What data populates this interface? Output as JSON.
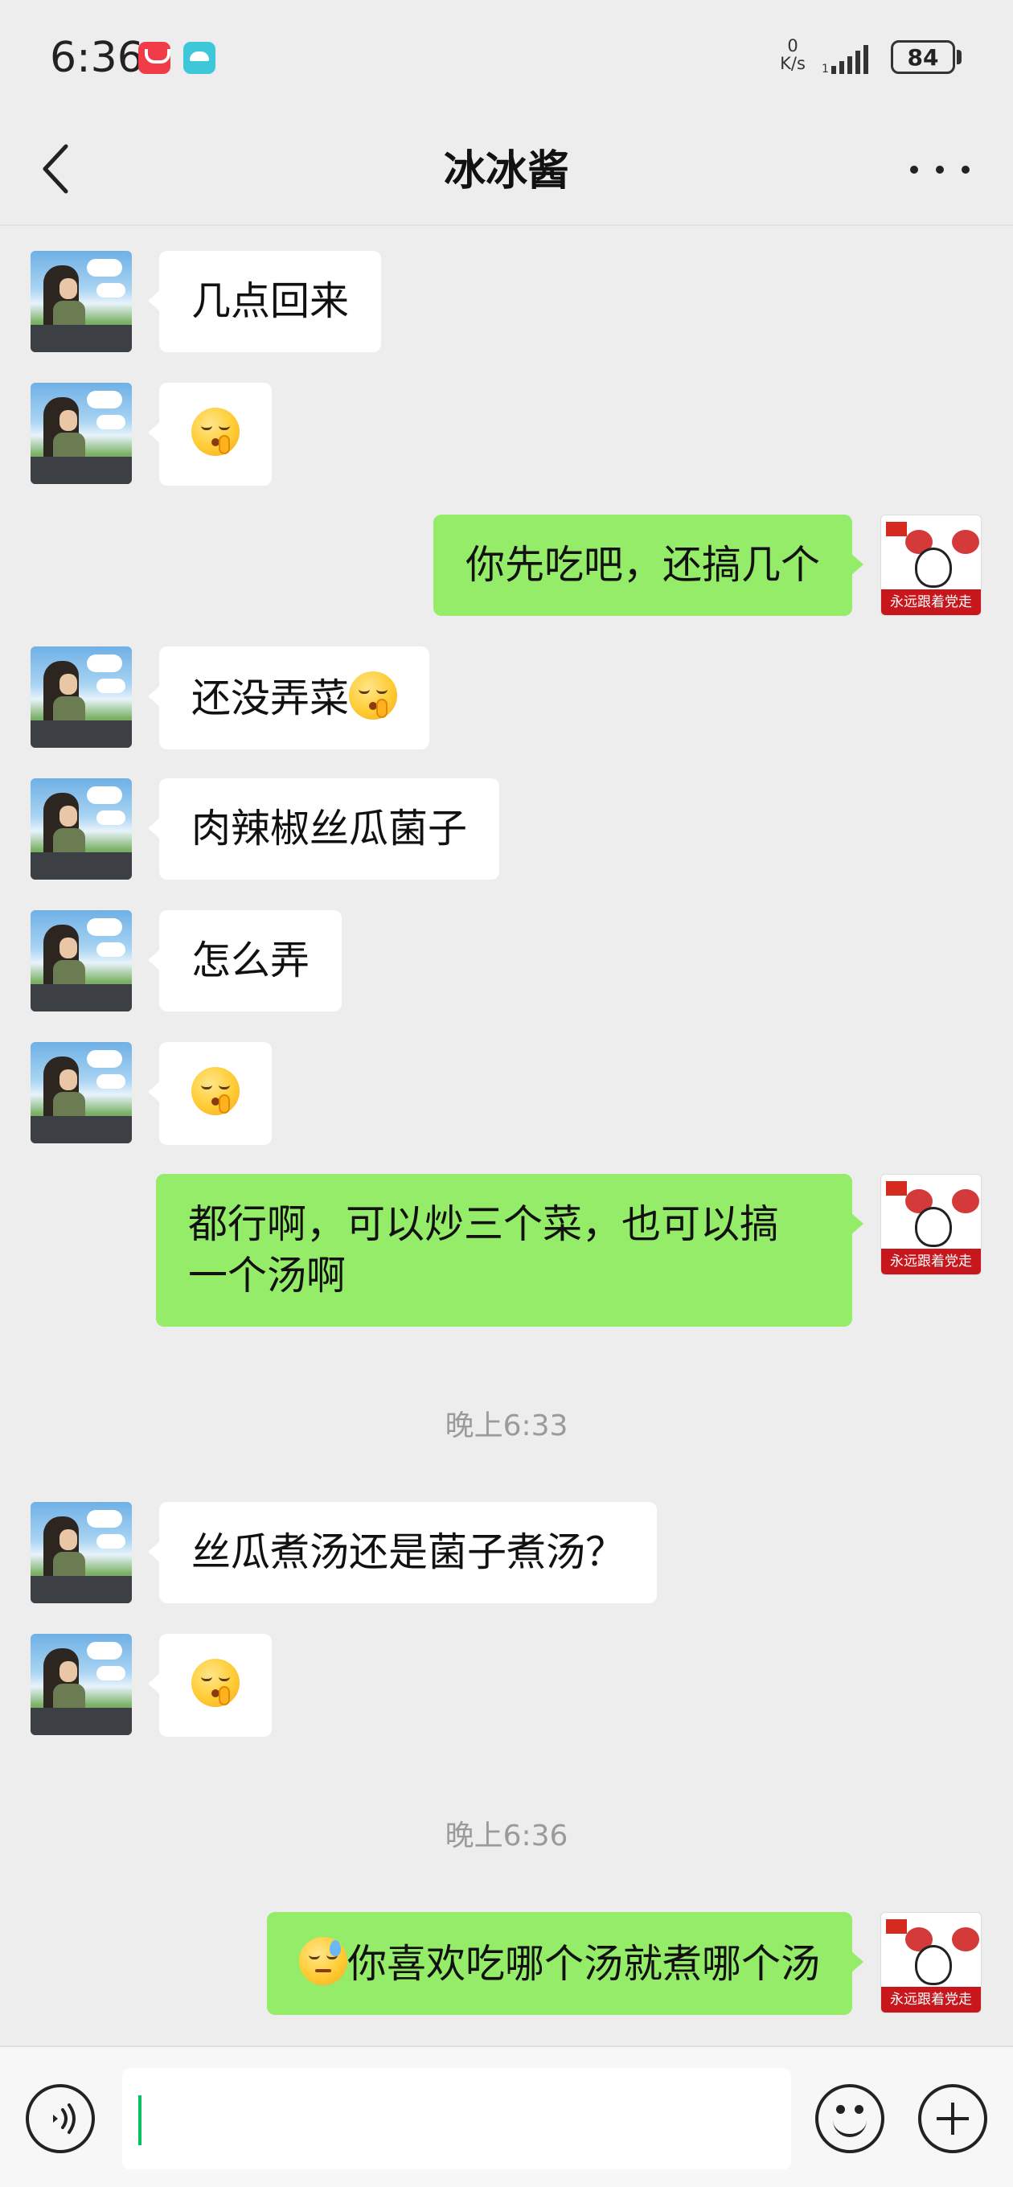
{
  "status_bar": {
    "time": "6:36",
    "net_speed_value": "0",
    "net_speed_unit": "K/s",
    "battery": "84",
    "icons": [
      "huawei-appgallery-icon",
      "camel-app-icon",
      "signal-icon",
      "battery-icon"
    ]
  },
  "header": {
    "title": "冰冰酱",
    "back_icon": "chevron-left-icon",
    "more_icon": "more-dots-icon"
  },
  "messages": [
    {
      "side": "left",
      "text": "几点回来",
      "emoji": null
    },
    {
      "side": "left",
      "text": "",
      "emoji": "shushing-face"
    },
    {
      "side": "right",
      "text": "你先吃吧，还搞几个",
      "emoji": null
    },
    {
      "side": "left",
      "text": "还没弄菜",
      "emoji": "shushing-face"
    },
    {
      "side": "left",
      "text": "肉辣椒丝瓜菌子",
      "emoji": null
    },
    {
      "side": "left",
      "text": "怎么弄",
      "emoji": null
    },
    {
      "side": "left",
      "text": "",
      "emoji": "shushing-face"
    },
    {
      "side": "right",
      "text_line1": "都行啊，可以炒三个菜，也可以搞",
      "text_line2": "一个汤啊",
      "emoji": null
    },
    {
      "type": "time",
      "text": "晚上6:33"
    },
    {
      "side": "left",
      "text": "丝瓜煮汤还是菌子煮汤？",
      "emoji": null
    },
    {
      "side": "left",
      "text": "",
      "emoji": "shushing-face"
    },
    {
      "type": "time",
      "text": "晚上6:36"
    },
    {
      "side": "right",
      "text": "你喜欢吃哪个汤就煮哪个汤",
      "emoji": "downcast-sweat-face"
    }
  ],
  "avatars": {
    "self_caption": "永远跟着党走"
  },
  "input_bar": {
    "value": "",
    "icons": [
      "voice-icon",
      "emoji-icon",
      "plus-icon"
    ]
  },
  "colors": {
    "background": "#ededed",
    "bubble_self": "#95ec69",
    "bubble_other": "#ffffff",
    "caret": "#07c160"
  }
}
